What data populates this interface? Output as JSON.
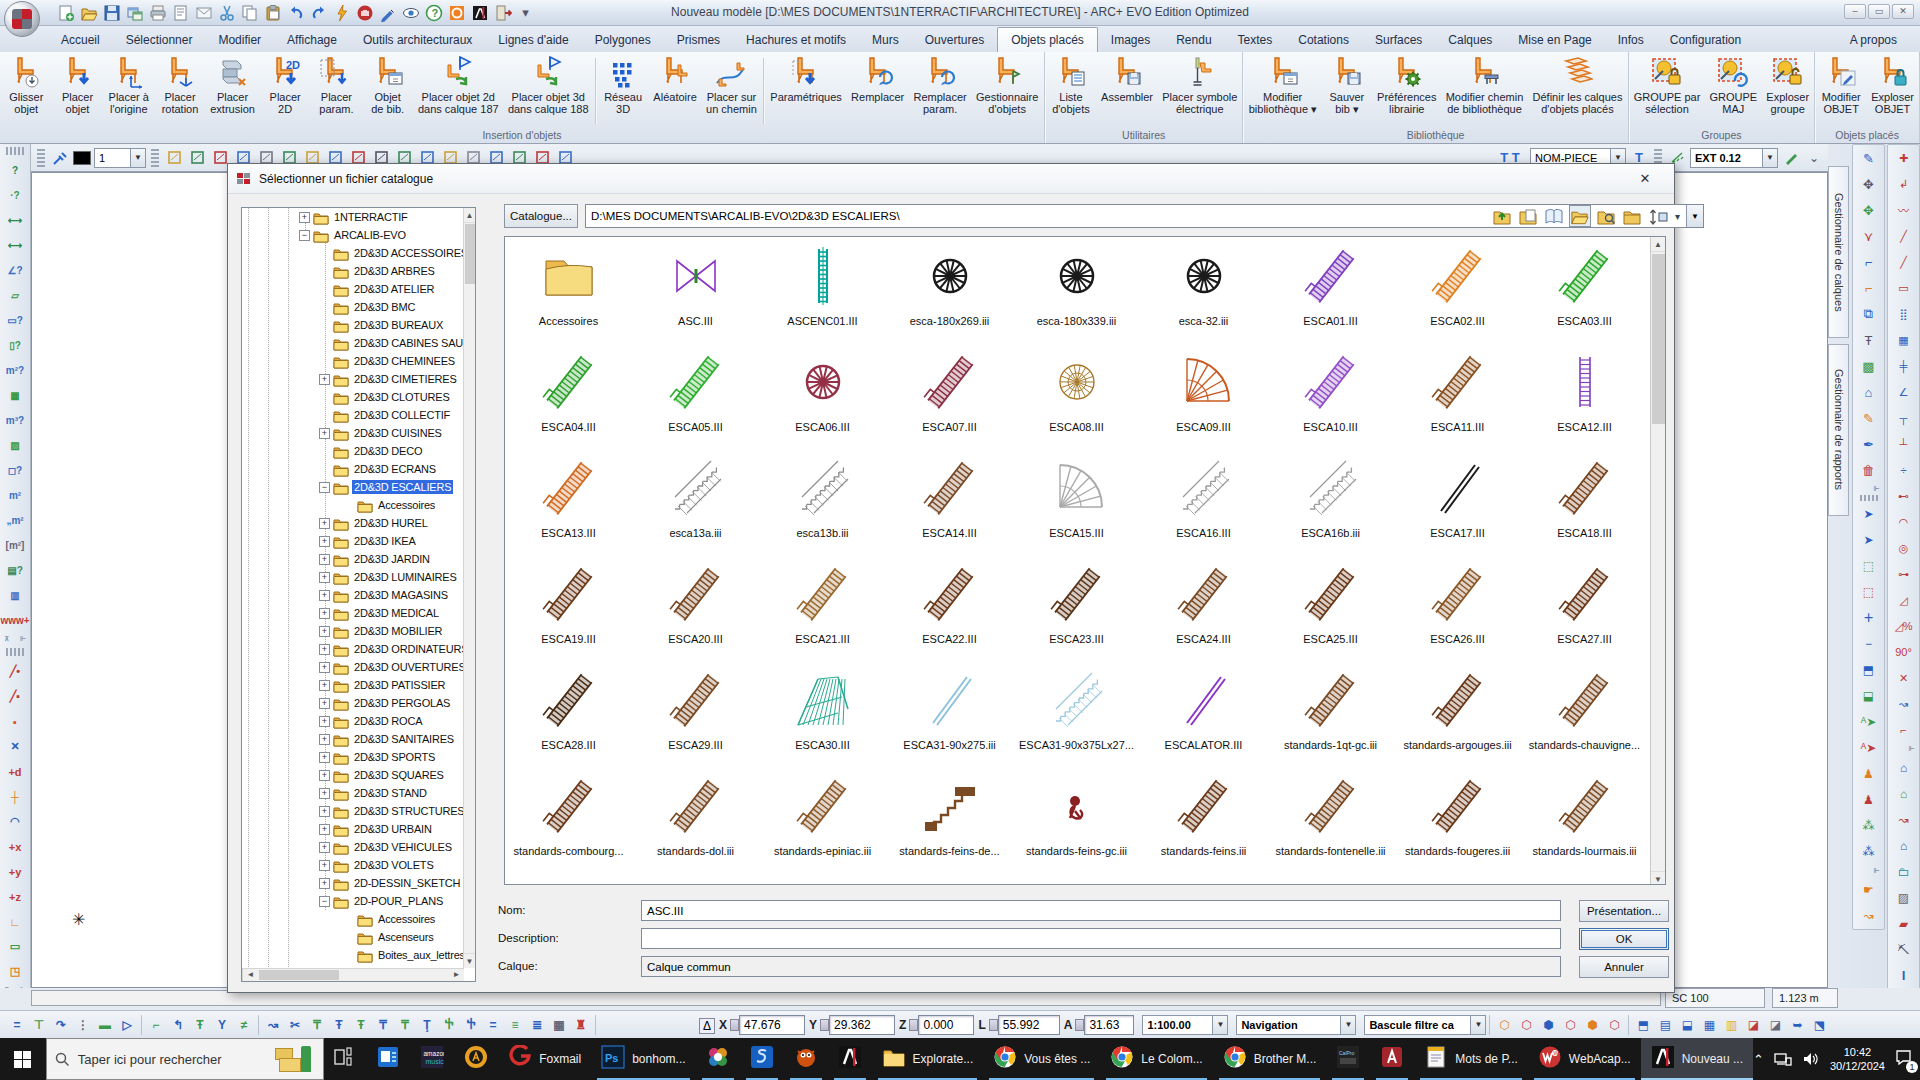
{
  "window": {
    "title": "Nouveau modèle [D:\\MES DOCUMENTS\\1NTERRACTIF\\ARCHITECTURE\\] - ARC+ EVO Edition Optimized",
    "controls": [
      "–",
      "▭",
      "✕"
    ]
  },
  "tabs": [
    "Accueil",
    "Sélectionner",
    "Modifier",
    "Affichage",
    "Outils architecturaux",
    "Lignes d'aide",
    "Polygones",
    "Prismes",
    "Hachures et motifs",
    "Murs",
    "Ouvertures",
    "Objets placés",
    "Images",
    "Rendu",
    "Textes",
    "Cotations",
    "Surfaces",
    "Calques",
    "Mise en Page",
    "Infos",
    "Configuration",
    "A propos"
  ],
  "active_tab": "Objets placés",
  "ribbon_groups": [
    {
      "label": "Insertion d'objets",
      "buttons": [
        {
          "label": "Glisser\nobjet",
          "icon": "chair-circ"
        },
        {
          "label": "Placer\nobjet",
          "icon": "chair-down"
        },
        {
          "label": "Placer à\nl'origine",
          "icon": "chair-axes"
        },
        {
          "label": "Placer\nrotation",
          "icon": "chair-tri"
        },
        {
          "label": "Placer\nextrusion",
          "icon": "beam"
        },
        {
          "label": "Placer\n2D",
          "icon": "chair-2d"
        },
        {
          "label": "Placer\nparam.",
          "icon": "chair-dash"
        },
        {
          "label": "Objet\nde bib.",
          "icon": "chair-win"
        },
        {
          "label": "Placer objet 2d\ndans calque 187",
          "icon": "flag"
        },
        {
          "label": "Placer objet 3d\ndans calque 188",
          "icon": "flag"
        },
        {
          "sep": true
        },
        {
          "label": "Réseau\n3D",
          "icon": "dots"
        },
        {
          "label": "Aléatoire",
          "icon": "chair-pair"
        },
        {
          "label": "Placer sur\nun chemin",
          "icon": "pathic"
        },
        {
          "sep": true
        },
        {
          "label": "Paramétriques",
          "icon": "chair-pdown"
        },
        {
          "label": "Remplacer",
          "icon": "chair-swap"
        },
        {
          "label": "Remplacer\nparam.",
          "icon": "chair-swap"
        },
        {
          "label": "Gestionnaire\nd'objets",
          "icon": "chair-flag"
        }
      ]
    },
    {
      "label": "Utilitaires",
      "buttons": [
        {
          "label": "Liste\nd'objets",
          "icon": "chair-list"
        },
        {
          "label": "Assembler",
          "icon": "chair-save"
        },
        {
          "label": "Placer symbole\nélectrique",
          "icon": "chair-thin"
        }
      ]
    },
    {
      "label": "Bibliothèque",
      "buttons": [
        {
          "label": "Modifier\nbibliothèque ▾",
          "icon": "chair-win"
        },
        {
          "label": "Sauver\nbib ▾",
          "icon": "chair-save"
        },
        {
          "label": "Préférences\nlibrairie",
          "icon": "chair-gear"
        },
        {
          "label": "Modifier chemin\nde bibliothèque",
          "icon": "chair-bench"
        },
        {
          "label": "Définir les calques\nd'objets placés",
          "icon": "layers"
        }
      ]
    },
    {
      "label": "Groupes",
      "buttons": [
        {
          "label": "GROUPE par\nsélection",
          "icon": "grp-lock"
        },
        {
          "label": "GROUPE\nMAJ",
          "icon": "grp-ref"
        },
        {
          "label": "Exploser\ngroupe",
          "icon": "grp-un"
        }
      ]
    },
    {
      "label": "Objets placés",
      "buttons": [
        {
          "label": "Modifier\nOBJET",
          "icon": "chair-pen"
        },
        {
          "label": "Exploser\nOBJET",
          "icon": "chair-lock"
        }
      ]
    }
  ],
  "toolstrip": {
    "layer_value": "1",
    "nom_piece": "NOM-PIECE",
    "ext_value": "EXT 0.12"
  },
  "panel_tabs": [
    "Gestionnaire de calques",
    "Gestionnaire de rapports"
  ],
  "dialog": {
    "title": "Sélectionner un fichier catalogue",
    "close": "✕",
    "catalogue_button": "Catalogue...",
    "path": "D:\\MES DOCUMENTS\\ARCALIB-EVO\\2D&3D ESCALIERS\\",
    "form": {
      "nom_label": "Nom:",
      "nom_value": "ASC.III",
      "description_label": "Description:",
      "description_value": "",
      "calque_label": "Calque:",
      "calque_value": "Calque commun",
      "presentation_button": "Présentation...",
      "ok_button": "OK",
      "annuler_button": "Annuler"
    },
    "tree": [
      {
        "label": "1NTERRACTIF",
        "lvl": 0,
        "exp": "+"
      },
      {
        "label": "ARCALIB-EVO",
        "lvl": 0,
        "exp": "-"
      },
      {
        "label": "2D&3D ACCESSOIRES",
        "lvl": 1
      },
      {
        "label": "2D&3D ARBRES",
        "lvl": 1
      },
      {
        "label": "2D&3D ATELIER",
        "lvl": 1
      },
      {
        "label": "2D&3D BMC",
        "lvl": 1
      },
      {
        "label": "2D&3D BUREAUX",
        "lvl": 1
      },
      {
        "label": "2D&3D CABINES SAU",
        "lvl": 1
      },
      {
        "label": "2D&3D CHEMINEES",
        "lvl": 1
      },
      {
        "label": "2D&3D CIMETIERES",
        "lvl": 1,
        "exp": "+"
      },
      {
        "label": "2D&3D CLOTURES",
        "lvl": 1
      },
      {
        "label": "2D&3D COLLECTIF",
        "lvl": 1
      },
      {
        "label": "2D&3D CUISINES",
        "lvl": 1,
        "exp": "+"
      },
      {
        "label": "2D&3D DECO",
        "lvl": 1
      },
      {
        "label": "2D&3D ECRANS",
        "lvl": 1
      },
      {
        "label": "2D&3D ESCALIERS",
        "lvl": 1,
        "exp": "-",
        "selected": true
      },
      {
        "label": "Accessoires",
        "lvl": 2
      },
      {
        "label": "2D&3D HUREL",
        "lvl": 1,
        "exp": "+"
      },
      {
        "label": "2D&3D IKEA",
        "lvl": 1,
        "exp": "+"
      },
      {
        "label": "2D&3D JARDIN",
        "lvl": 1,
        "exp": "+"
      },
      {
        "label": "2D&3D LUMINAIRES",
        "lvl": 1,
        "exp": "+"
      },
      {
        "label": "2D&3D MAGASINS",
        "lvl": 1,
        "exp": "+"
      },
      {
        "label": "2D&3D MEDICAL",
        "lvl": 1,
        "exp": "+"
      },
      {
        "label": "2D&3D MOBILIER",
        "lvl": 1,
        "exp": "+"
      },
      {
        "label": "2D&3D ORDINATEURS",
        "lvl": 1,
        "exp": "+"
      },
      {
        "label": "2D&3D OUVERTURES",
        "lvl": 1,
        "exp": "+"
      },
      {
        "label": "2D&3D PATISSIER",
        "lvl": 1,
        "exp": "+"
      },
      {
        "label": "2D&3D PERGOLAS",
        "lvl": 1,
        "exp": "+"
      },
      {
        "label": "2D&3D ROCA",
        "lvl": 1,
        "exp": "+"
      },
      {
        "label": "2D&3D SANITAIRES",
        "lvl": 1,
        "exp": "+"
      },
      {
        "label": "2D&3D SPORTS",
        "lvl": 1,
        "exp": "+"
      },
      {
        "label": "2D&3D SQUARES",
        "lvl": 1,
        "exp": "+"
      },
      {
        "label": "2D&3D STAND",
        "lvl": 1,
        "exp": "+"
      },
      {
        "label": "2D&3D STRUCTURES",
        "lvl": 1,
        "exp": "+"
      },
      {
        "label": "2D&3D URBAIN",
        "lvl": 1,
        "exp": "+"
      },
      {
        "label": "2D&3D VEHICULES",
        "lvl": 1,
        "exp": "+"
      },
      {
        "label": "2D&3D VOLETS",
        "lvl": 1,
        "exp": "+"
      },
      {
        "label": "2D-DESSIN_SKETCH",
        "lvl": 1,
        "exp": "+"
      },
      {
        "label": "2D-POUR_PLANS",
        "lvl": 1,
        "exp": "-"
      },
      {
        "label": "Accessoires",
        "lvl": 2
      },
      {
        "label": "Ascenseurs",
        "lvl": 2
      },
      {
        "label": "Boites_aux_lettres",
        "lvl": 2
      }
    ],
    "files": [
      {
        "name": "Accessoires",
        "variant": "folder",
        "color": "#f0c95c"
      },
      {
        "name": "ASC.III",
        "variant": "xbox",
        "color": "#8a35c8"
      },
      {
        "name": "ASCENC01.III",
        "variant": "ladder",
        "color": "#00a49a"
      },
      {
        "name": "esca-180x269.iii",
        "variant": "spiral",
        "color": "#1b1b1b"
      },
      {
        "name": "esca-180x339.iii",
        "variant": "spiral",
        "color": "#1b1b1b"
      },
      {
        "name": "esca-32.iii",
        "variant": "spiral",
        "color": "#1b1b1b"
      },
      {
        "name": "ESCA01.III",
        "variant": "straight",
        "color": "#8040c0"
      },
      {
        "name": "ESCA02.III",
        "variant": "straight",
        "color": "#e08020"
      },
      {
        "name": "ESCA03.III",
        "variant": "straight",
        "color": "#28a828"
      },
      {
        "name": "ESCA04.III",
        "variant": "straight",
        "color": "#2da02d"
      },
      {
        "name": "ESCA05.III",
        "variant": "straight",
        "color": "#2fae2f"
      },
      {
        "name": "ESCA06.III",
        "variant": "spiral",
        "color": "#963048"
      },
      {
        "name": "ESCA07.III",
        "variant": "straight",
        "color": "#8a3045"
      },
      {
        "name": "ESCA08.III",
        "variant": "spiralmesh",
        "color": "#a87828"
      },
      {
        "name": "ESCA09.III",
        "variant": "fan",
        "color": "#c85a20"
      },
      {
        "name": "ESCA10.III",
        "variant": "straight",
        "color": "#9450c8"
      },
      {
        "name": "ESCA11.III",
        "variant": "straight",
        "color": "#8a5020"
      },
      {
        "name": "ESCA12.III",
        "variant": "vert",
        "color": "#8040c0"
      },
      {
        "name": "ESCA13.III",
        "variant": "straight",
        "color": "#d2691e"
      },
      {
        "name": "esca13a.iii",
        "variant": "rail",
        "color": "#8d8d8d"
      },
      {
        "name": "esca13b.iii",
        "variant": "rail",
        "color": "#8d8d8d"
      },
      {
        "name": "ESCA14.III",
        "variant": "straight",
        "color": "#7a4a28"
      },
      {
        "name": "ESCA15.III",
        "variant": "fan",
        "color": "#aaaaaa"
      },
      {
        "name": "ESCA16.III",
        "variant": "rail",
        "color": "#9a9a9a"
      },
      {
        "name": "ESCA16b.iii",
        "variant": "rail",
        "color": "#9a9a9a"
      },
      {
        "name": "ESCA17.III",
        "variant": "thin",
        "color": "#1c1c1c"
      },
      {
        "name": "ESCA18.III",
        "variant": "straight",
        "color": "#7a4520"
      },
      {
        "name": "ESCA19.III",
        "variant": "straight",
        "color": "#6b3a1a"
      },
      {
        "name": "ESCA20.III",
        "variant": "straight",
        "color": "#7a4a24"
      },
      {
        "name": "ESCA21.III",
        "variant": "straight",
        "color": "#9a6a30"
      },
      {
        "name": "ESCA22.III",
        "variant": "straight",
        "color": "#6b3a1a"
      },
      {
        "name": "ESCA23.III",
        "variant": "straight",
        "color": "#5a3418"
      },
      {
        "name": "ESCA24.III",
        "variant": "straight",
        "color": "#7a4a24"
      },
      {
        "name": "ESCA25.III",
        "variant": "straight",
        "color": "#6b3a1a"
      },
      {
        "name": "ESCA26.III",
        "variant": "straight",
        "color": "#8a5828"
      },
      {
        "name": "ESCA27.III",
        "variant": "straight",
        "color": "#6b3a1a"
      },
      {
        "name": "ESCA28.III",
        "variant": "straight",
        "color": "#4a2c14"
      },
      {
        "name": "ESCA29.III",
        "variant": "straight",
        "color": "#7a4a24"
      },
      {
        "name": "ESCA30.III",
        "variant": "mesh",
        "color": "#2aab92"
      },
      {
        "name": "ESCA31-90x275.iii",
        "variant": "thin",
        "color": "#8fc2dc"
      },
      {
        "name": "ESCA31-90x375Lx27...",
        "variant": "rail",
        "color": "#9cc8de"
      },
      {
        "name": "ESCALATOR.III",
        "variant": "thin",
        "color": "#8a35c8"
      },
      {
        "name": "standards-1qt-gc.iii",
        "variant": "straight",
        "color": "#7a4a24"
      },
      {
        "name": "standards-argouges.iii",
        "variant": "straight",
        "color": "#6b3a1a"
      },
      {
        "name": "standards-chauvigne...",
        "variant": "straight",
        "color": "#7a4a24"
      },
      {
        "name": "standards-combourg...",
        "variant": "straight",
        "color": "#6b3a1a"
      },
      {
        "name": "standards-dol.iii",
        "variant": "straight",
        "color": "#7a4a24"
      },
      {
        "name": "standards-epiniac.iii",
        "variant": "straight",
        "color": "#8a5828"
      },
      {
        "name": "standards-feins-de...",
        "variant": "wide",
        "color": "#7a4a24"
      },
      {
        "name": "standards-feins-gc.iii",
        "variant": "figure",
        "color": "#8a2020"
      },
      {
        "name": "standards-feins.iii",
        "variant": "straight",
        "color": "#6b3a1a"
      },
      {
        "name": "standards-fontenelle.iii",
        "variant": "straight",
        "color": "#7a4a24"
      },
      {
        "name": "standards-fougeres.iii",
        "variant": "straight",
        "color": "#6b3a1a"
      },
      {
        "name": "standards-lourmais.iii",
        "variant": "straight",
        "color": "#7a4a24"
      }
    ]
  },
  "statusbar": {
    "coords": [
      {
        "label": "X",
        "value": "47.676"
      },
      {
        "label": "Y",
        "value": "29.362"
      },
      {
        "label": "Z",
        "value": "0.000"
      },
      {
        "label": "L",
        "value": "55.992"
      },
      {
        "label": "A",
        "value": "31.63"
      }
    ],
    "scale_combo": "1:100.00",
    "nav_combo": "Navigation",
    "filter_combo": "Bascule filtre ca",
    "sc_box": "SC 100",
    "measure_box": "1.123 m"
  },
  "taskbar": {
    "search_placeholder": "Taper ici pour rechercher",
    "items": [
      {
        "style": "taskview",
        "label": "",
        "open": false,
        "name": "task-view-button"
      },
      {
        "style": "bluedoc",
        "label": "",
        "open": false,
        "name": "app-bluedoc"
      },
      {
        "style": "amazon",
        "label": "",
        "open": false,
        "name": "app-amazon-music"
      },
      {
        "style": "orangeA",
        "label": "",
        "open": false,
        "name": "app-orange-a"
      },
      {
        "style": "foxmail",
        "label": "Foxmail",
        "open": false,
        "name": "app-foxmail"
      },
      {
        "style": "ps",
        "label": "bonhom...",
        "open": true,
        "name": "app-photoshop"
      },
      {
        "style": "flower",
        "label": "",
        "open": true,
        "name": "app-flower"
      },
      {
        "style": "blues",
        "label": "",
        "open": true,
        "name": "app-blue-s"
      },
      {
        "style": "creature",
        "label": "",
        "open": true,
        "name": "app-creature"
      },
      {
        "style": "arcplus",
        "label": "",
        "open": true,
        "name": "app-arcplus"
      },
      {
        "style": "folder",
        "label": "Explorate...",
        "open": true,
        "name": "app-explorer"
      },
      {
        "style": "chrome",
        "label": "Vous êtes ...",
        "open": true,
        "name": "app-chrome-1"
      },
      {
        "style": "chrome",
        "label": "Le Colom...",
        "open": true,
        "name": "app-chrome-2"
      },
      {
        "style": "chrome",
        "label": "Brother M...",
        "open": true,
        "name": "app-chrome-3"
      },
      {
        "style": "darktile",
        "label": "",
        "open": true,
        "name": "app-darktile"
      },
      {
        "style": "redA",
        "label": "",
        "open": true,
        "name": "app-red-a"
      },
      {
        "style": "notepad",
        "label": "Mots de P...",
        "open": true,
        "name": "app-notepad"
      },
      {
        "style": "webacap",
        "label": "WebAcap...",
        "open": true,
        "name": "app-webacappella"
      },
      {
        "style": "arcplus",
        "label": "Nouveau ...",
        "open": true,
        "active": true,
        "name": "app-arcplus-active"
      }
    ],
    "tray": {
      "time": "10:42",
      "date": "30/12/2024",
      "badge": "1"
    }
  }
}
